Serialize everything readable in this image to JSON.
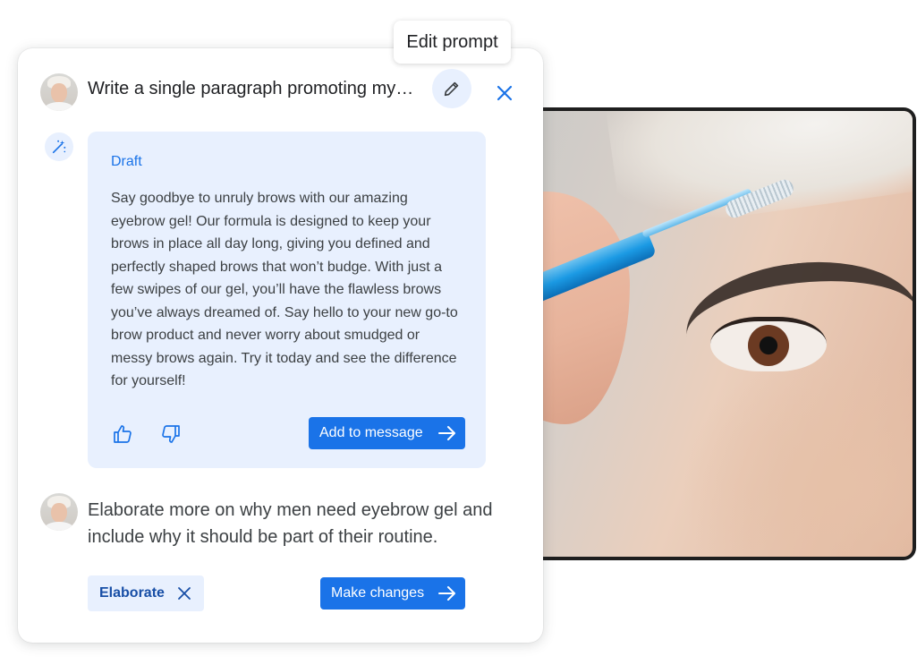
{
  "tooltip": {
    "text": "Edit prompt"
  },
  "prompt": {
    "title": "Write a single paragraph promoting my…"
  },
  "icons": {
    "edit": "pencil-icon",
    "close": "close-icon",
    "sparkle": "magic-wand-icon",
    "thumb_up": "thumbs-up-icon",
    "thumb_down": "thumbs-down-icon",
    "arrow": "arrow-right-icon",
    "chip_close": "close-icon"
  },
  "draft": {
    "label": "Draft",
    "text": "Say goodbye to unruly brows with our amazing eyebrow gel! Our formula is designed to keep your brows in place all day long, giving you defined and perfectly shaped brows that won’t budge. With just a few swipes of our gel, you’ll have the flawless brows you’ve always dreamed of. Say hello to your new go-to brow product and never worry about smudged or messy brows again. Try it today and see the difference for yourself!",
    "add_button": "Add to message"
  },
  "followup": {
    "text": "Elaborate more on why men need eyebrow gel and include why it should be part of their routine.",
    "chip_label": "Elaborate",
    "make_button": "Make changes"
  },
  "colors": {
    "accent": "#1a73e8",
    "panel": "#e8f0fe",
    "chip_text": "#174ea6"
  }
}
